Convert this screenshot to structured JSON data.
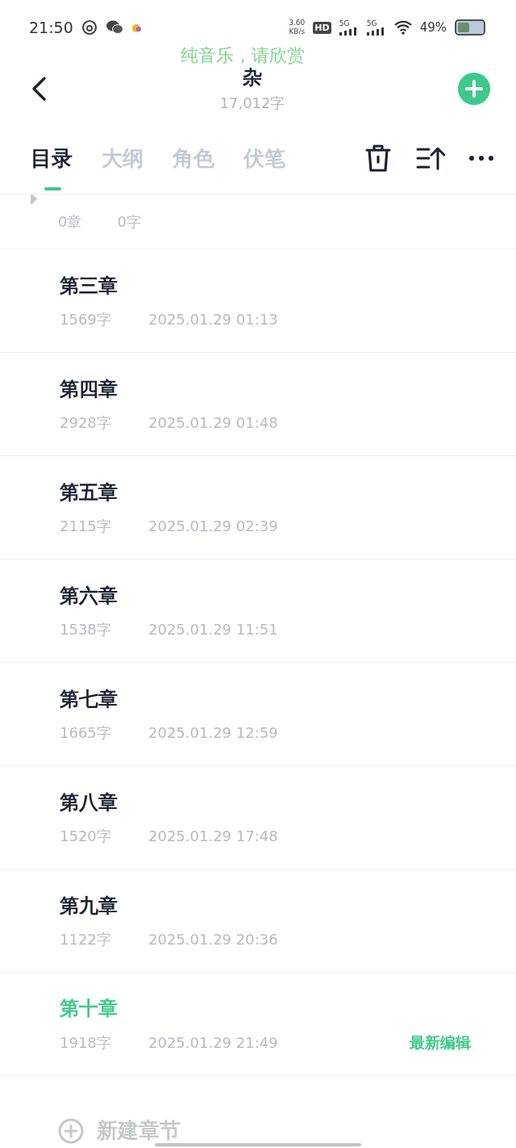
{
  "status_bar": {
    "time": "21:50",
    "speed_value": "3.60",
    "speed_unit": "KB/s",
    "hd": "HD",
    "sims": [
      "5G",
      "5G"
    ],
    "battery": "49%"
  },
  "lyric_overlay": "纯音乐，请欣赏",
  "header": {
    "title": "杂",
    "word_count": "17,012字"
  },
  "tabs": [
    {
      "label": "目录",
      "selected": true
    },
    {
      "label": "大纲",
      "selected": false
    },
    {
      "label": "角色",
      "selected": false
    },
    {
      "label": "伏笔",
      "selected": false
    }
  ],
  "partial_row": {
    "chapters": "0章",
    "words": "0字"
  },
  "chapters": [
    {
      "title": "第三章",
      "words": "1569字",
      "time": "2025.01.29 01:13",
      "latest": false
    },
    {
      "title": "第四章",
      "words": "2928字",
      "time": "2025.01.29 01:48",
      "latest": false
    },
    {
      "title": "第五章",
      "words": "2115字",
      "time": "2025.01.29 02:39",
      "latest": false
    },
    {
      "title": "第六章",
      "words": "1538字",
      "time": "2025.01.29 11:51",
      "latest": false
    },
    {
      "title": "第七章",
      "words": "1665字",
      "time": "2025.01.29 12:59",
      "latest": false
    },
    {
      "title": "第八章",
      "words": "1520字",
      "time": "2025.01.29 17:48",
      "latest": false
    },
    {
      "title": "第九章",
      "words": "1122字",
      "time": "2025.01.29 20:36",
      "latest": false
    },
    {
      "title": "第十章",
      "words": "1918字",
      "time": "2025.01.29 21:49",
      "latest": true,
      "badge": "最新编辑"
    }
  ],
  "new_chapter": "新建章节"
}
